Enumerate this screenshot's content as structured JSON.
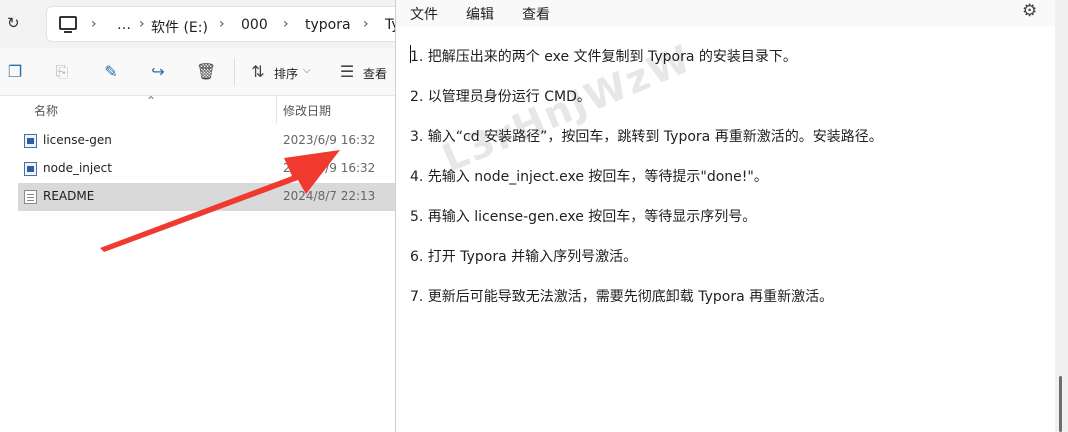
{
  "explorer": {
    "breadcrumb": [
      "…",
      "软件 (E:)",
      "000",
      "typora",
      "Ty"
    ],
    "toolbar": {
      "sort_label": "排序",
      "view_label": "查看"
    },
    "columns": {
      "name": "名称",
      "date": "修改日期"
    },
    "files": [
      {
        "name": "license-gen",
        "date": "2023/6/9 16:32",
        "type": "exe"
      },
      {
        "name": "node_inject",
        "date": "2023/6/9 16:32",
        "type": "exe"
      },
      {
        "name": "README",
        "date": "2024/8/7 22:13",
        "type": "txt"
      }
    ]
  },
  "notepad": {
    "menu": [
      "文件",
      "编辑",
      "查看"
    ],
    "lines": [
      "1. 把解压出来的两个 exe 文件复制到 Typora 的安装目录下。",
      "2. 以管理员身份运行 CMD。",
      "3. 输入“cd 安装路径”，按回车，跳转到 Typora 再重新激活的。安装路径。",
      "4. 先输入 node_inject.exe 按回车，等待提示\"done!\"。",
      "5. 再输入 license-gen.exe 按回车，等待显示序列号。",
      "6. 打开 Typora 并输入序列号激活。",
      "7. 更新后可能导致无法激活，需要先彻底卸载 Typora 再重新激活。"
    ],
    "watermark": "L3rHnJWzW"
  },
  "colors": {
    "arrow": "#f03a2f",
    "selected_row": "#d9d9d9"
  }
}
